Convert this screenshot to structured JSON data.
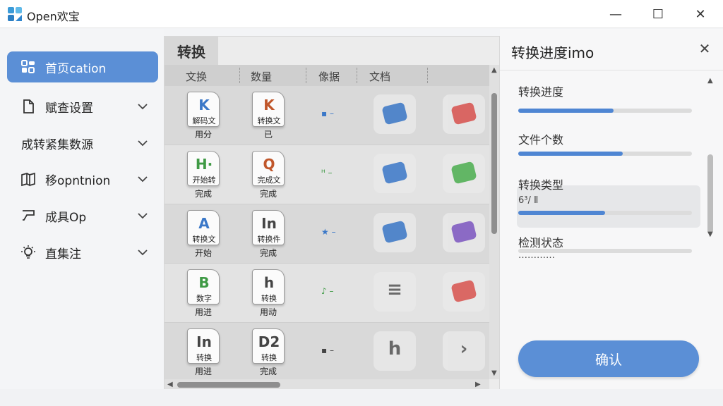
{
  "window": {
    "title": "Open欢宝",
    "minimize": "—",
    "maximize": "☐",
    "close": "✕"
  },
  "sidebar": {
    "items": [
      {
        "label": "首页cation",
        "icon": "dashboard-icon",
        "active": true
      },
      {
        "label": "赋查设置",
        "icon": "document-icon"
      },
      {
        "label": "成转紧集数源",
        "icon": ""
      },
      {
        "label": "移opntnion",
        "icon": "book-icon"
      },
      {
        "label": "成具Op",
        "icon": "paint-roller-icon"
      },
      {
        "label": "直集注",
        "icon": "bulb-icon"
      }
    ]
  },
  "main": {
    "tab": "转换",
    "columns": [
      "文换",
      "数量",
      "像据",
      "文档"
    ],
    "rows": [
      {
        "file1": {
          "glyph": "K",
          "sub": "解码文",
          "caption": "用分",
          "color": "#3b78c8"
        },
        "file2": {
          "glyph": "K",
          "sub": "转换文",
          "caption": "已",
          "color": "#c0562a"
        },
        "mini": "▪ –"
      },
      {
        "file1": {
          "glyph": "H·",
          "sub": "开始转",
          "caption": "完成",
          "color": "#3f9a45"
        },
        "file2": {
          "glyph": "Q",
          "sub": "完成文",
          "caption": "完成",
          "color": "#c0562a"
        },
        "mini": "ᴴ –"
      },
      {
        "file1": {
          "glyph": "A",
          "sub": "转换文",
          "caption": "开始",
          "color": "#3b78c8"
        },
        "file2": {
          "glyph": "In",
          "sub": "转换件",
          "caption": "完成",
          "color": "#444444"
        },
        "mini": "★ –"
      },
      {
        "file1": {
          "glyph": "B",
          "sub": "数字",
          "caption": "用进",
          "color": "#3f9a45"
        },
        "file2": {
          "glyph": "h",
          "sub": "转换",
          "caption": "用动",
          "color": "#444444"
        },
        "mini": "♪ –"
      },
      {
        "file1": {
          "glyph": "In",
          "sub": "转换",
          "caption": "用进",
          "color": "#444444"
        },
        "file2": {
          "glyph": "D2",
          "sub": "转换",
          "caption": "完成",
          "color": "#444444"
        },
        "mini": "▪ –"
      }
    ],
    "tile_colors": [
      [
        "#3b78c8",
        "#d9534f"
      ],
      [
        "#3b78c8",
        "#4caf50"
      ],
      [
        "#3b78c8",
        "#7e57c2"
      ],
      [
        "#444444",
        "#d9534f"
      ],
      [
        "#444444",
        "#666666"
      ]
    ],
    "tile_texts": [
      "",
      "",
      "",
      "≡",
      "h"
    ],
    "tile_texts2": [
      "",
      "",
      "",
      "",
      "›"
    ]
  },
  "panel": {
    "title": "转换进度imo",
    "close": "✕",
    "progress": [
      {
        "label": "转换进度",
        "value": 0.55
      },
      {
        "label": "文件个数",
        "value": 0.6
      },
      {
        "label": "转换类型",
        "sub": "6³/ Ⅱ",
        "value": 0.5
      },
      {
        "label": "检测状态",
        "sub": "…………",
        "value": 0.0
      }
    ],
    "button": "确认"
  },
  "colors": {
    "accent": "#5b8fd6",
    "bar": "#4f86d3"
  }
}
